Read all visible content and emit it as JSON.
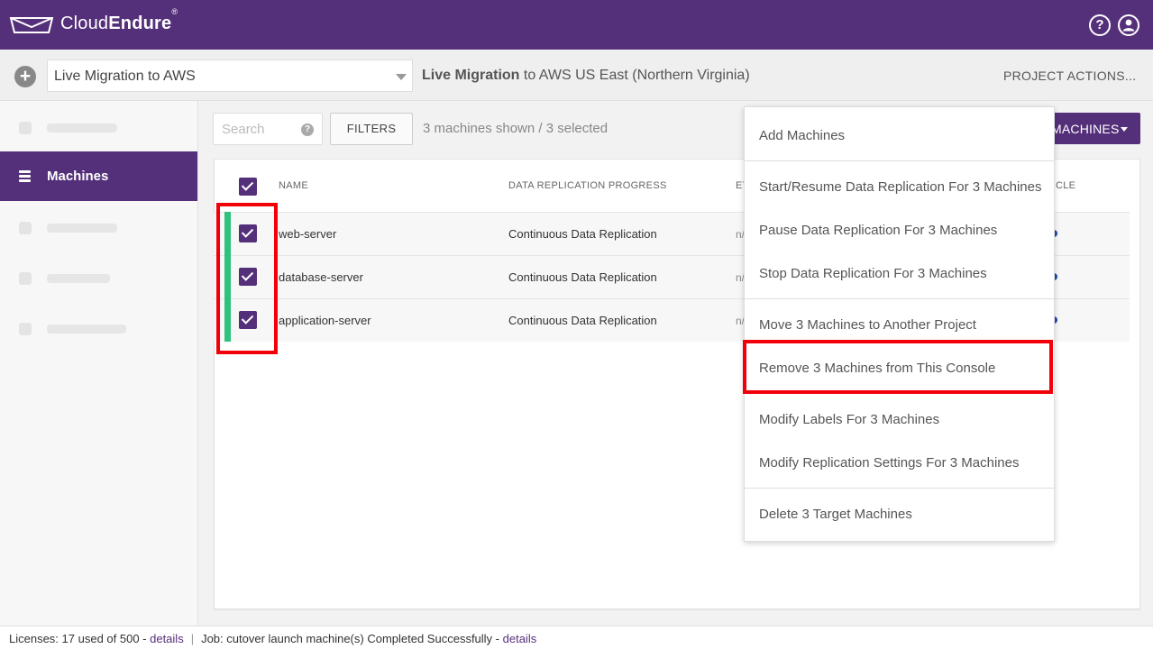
{
  "header": {
    "brand_light": "Cloud",
    "brand_bold": "Endure",
    "brand_reg": "®",
    "help_icon": "help-icon",
    "user_icon": "user-icon"
  },
  "project_bar": {
    "add_symbol": "+",
    "project_select_value": "Live Migration to AWS",
    "title_bold": "Live Migration",
    "title_rest": " to AWS US East (Northern Virginia)",
    "project_actions": "PROJECT ACTIONS..."
  },
  "sidebar": {
    "active_item": "Machines"
  },
  "toolbar": {
    "search_placeholder": "Search",
    "search_help": "?",
    "filters": "FILTERS",
    "shown_text": "3 machines shown / 3 selected",
    "machines_button": "MACHINES"
  },
  "table": {
    "headers": {
      "name": "NAME",
      "progress": "DATA REPLICATION PROGRESS",
      "eta_partial": "ET",
      "last_partial": "CLE"
    },
    "rows": [
      {
        "name": "web-server",
        "progress": "Continuous Data Replication",
        "eta": "n/"
      },
      {
        "name": "database-server",
        "progress": "Continuous Data Replication",
        "eta": "n/"
      },
      {
        "name": "application-server",
        "progress": "Continuous Data Replication",
        "eta": "n/"
      }
    ]
  },
  "menu": {
    "items": [
      "Add Machines",
      "Start/Resume Data Replication For 3 Machines",
      "Pause Data Replication For 3 Machines",
      "Stop Data Replication For 3 Machines",
      "Move 3 Machines to Another Project",
      "Remove 3 Machines from This Console",
      "Modify Labels For 3 Machines",
      "Modify Replication Settings For 3 Machines",
      "Delete 3 Target Machines"
    ]
  },
  "footer": {
    "licenses_label": "Licenses:  17 used of 500 - ",
    "licenses_link": "details",
    "separator": "|",
    "job_label": "Job:  cutover launch machine(s) Completed Successfully - ",
    "job_link": "details"
  },
  "colors": {
    "brand_purple": "#55307a",
    "success_green": "#2ec27e",
    "highlight_red": "#f2000a"
  }
}
